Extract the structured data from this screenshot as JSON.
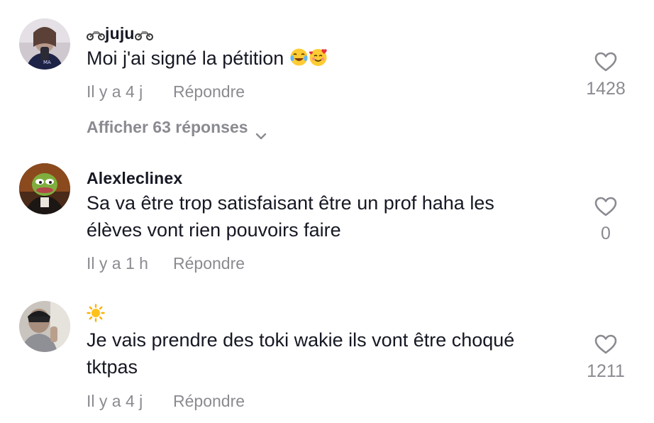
{
  "comments": [
    {
      "username": "juju",
      "username_emoji": "motorcycle-icon",
      "text": "Moi j'ai signé la pétition",
      "text_emojis": [
        "tears-of-joy-emoji",
        "smiling-face-with-hearts-emoji"
      ],
      "time": "Il y a 4 j",
      "reply_label": "Répondre",
      "likes": "1428",
      "view_replies": "Afficher 63 réponses"
    },
    {
      "username": "Alexleclinex",
      "text": "Sa va être trop satisfaisant être un prof haha les élèves vont rien pouvoirs faire",
      "time": "Il y a 1 h",
      "reply_label": "Répondre",
      "likes": "0"
    },
    {
      "username": "",
      "username_emoji": "sun-icon",
      "text": "Je vais prendre des toki wakie ils vont être choqué tktpas",
      "time": "Il y a 4 j",
      "reply_label": "Répondre",
      "likes": "1211"
    }
  ],
  "colors": {
    "primary_text": "#161823",
    "secondary_text": "#8a8b91",
    "background": "#ffffff"
  }
}
